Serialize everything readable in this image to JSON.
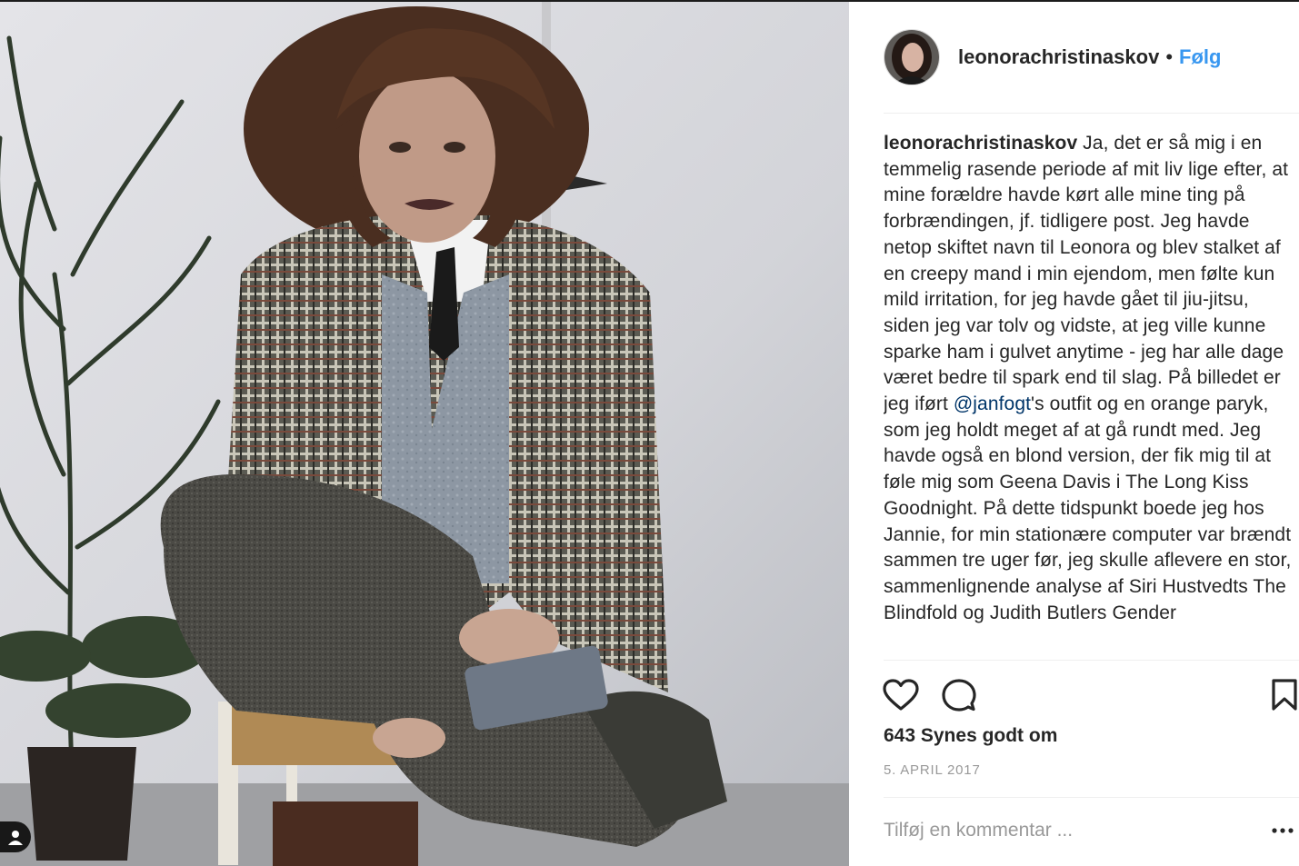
{
  "post": {
    "username": "leonorachristinaskov",
    "separator": "•",
    "follow_label": "Følg",
    "caption": {
      "username": "leonorachristinaskov",
      "text_before": " Ja, det er så mig i en temmelig rasende periode af mit liv lige efter, at mine forældre havde kørt alle mine ting på forbrændingen, jf. tidligere post. Jeg havde netop skiftet navn til Leonora og blev stalket af en creepy mand i min ejendom, men følte kun mild irritation, for jeg havde gået til jiu-jitsu, siden jeg var tolv og vidste, at jeg ville kunne sparke ham i gulvet anytime - jeg har alle dage været bedre til spark end til slag. På billedet er jeg iført ",
      "mention": "@janfogt",
      "text_after": "'s outfit og en orange paryk, som jeg holdt meget af at gå rundt med. Jeg havde også en blond version, der fik mig til at føle mig som Geena Davis i The Long Kiss Goodnight. På dette tidspunkt boede jeg hos Jannie, for min stationære computer var brændt sammen tre uger før, jeg skulle aflevere en stor, sammenlignende analyse af Siri Hustvedts The Blindfold og Judith Butlers Gender"
    },
    "likes_text": "643 Synes godt om",
    "date": "5. APRIL 2017",
    "comment_placeholder": "Tilføj en kommentar ..."
  },
  "icons": {
    "like": "heart-icon",
    "comment": "comment-bubble-icon",
    "save": "bookmark-icon",
    "more": "more-horizontal-icon",
    "user_tag": "user-tag-icon"
  },
  "colors": {
    "follow": "#3897f0",
    "mention": "#003569",
    "text": "#262626",
    "muted": "#999999",
    "divider": "#efefef"
  }
}
